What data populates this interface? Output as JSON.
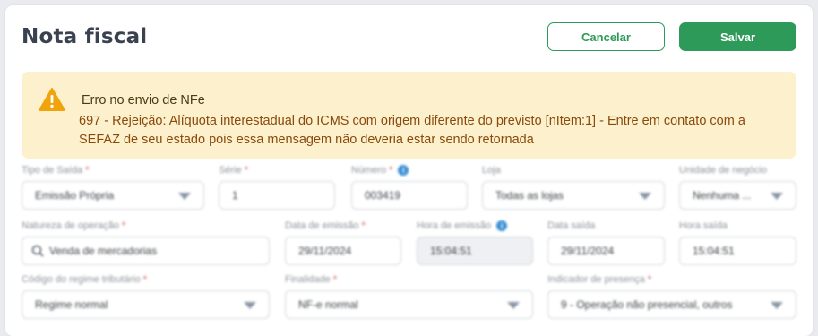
{
  "header": {
    "title": "Nota fiscal",
    "cancel_label": "Cancelar",
    "save_label": "Salvar"
  },
  "alert": {
    "title": "Erro no envio de NFe",
    "message": "697 - Rejeição: Alíquota interestadual do ICMS com origem diferente do previsto [nItem:1] - Entre em contato com a SEFAZ de seu estado pois essa mensagem não deveria estar sendo retornada",
    "icon": "warning-icon",
    "color": "#f0a30a"
  },
  "form": {
    "tipo_saida": {
      "label": "Tipo de Saída",
      "value": "Emissão Própria"
    },
    "serie": {
      "label": "Série",
      "value": "1"
    },
    "numero": {
      "label": "Número",
      "value": "003419"
    },
    "loja": {
      "label": "Loja",
      "value": "Todas as lojas"
    },
    "unidade_negocio": {
      "label": "Unidade de negócio",
      "value": "Nenhuma ..."
    },
    "natureza_operacao": {
      "label": "Natureza de operação",
      "value": "Venda de mercadorias"
    },
    "data_emissao": {
      "label": "Data de emissão",
      "value": "29/11/2024"
    },
    "hora_emissao": {
      "label": "Hora de emissão",
      "value": "15:04:51"
    },
    "data_saida": {
      "label": "Data saída",
      "value": "29/11/2024"
    },
    "hora_saida": {
      "label": "Hora saída",
      "value": "15:04:51"
    },
    "codigo_regime": {
      "label": "Código do regime tributário",
      "value": "Regime normal"
    },
    "finalidade": {
      "label": "Finalidade",
      "value": "NF-e normal"
    },
    "indicador_presenca": {
      "label": "Indicador de presença",
      "value": "9 - Operação não presencial, outros"
    }
  },
  "colors": {
    "primary": "#2e9a59",
    "alert_bg": "#fdf0cd",
    "alert_text": "#8a4a0b",
    "required": "#d9534f",
    "info": "#3a8fd6"
  }
}
